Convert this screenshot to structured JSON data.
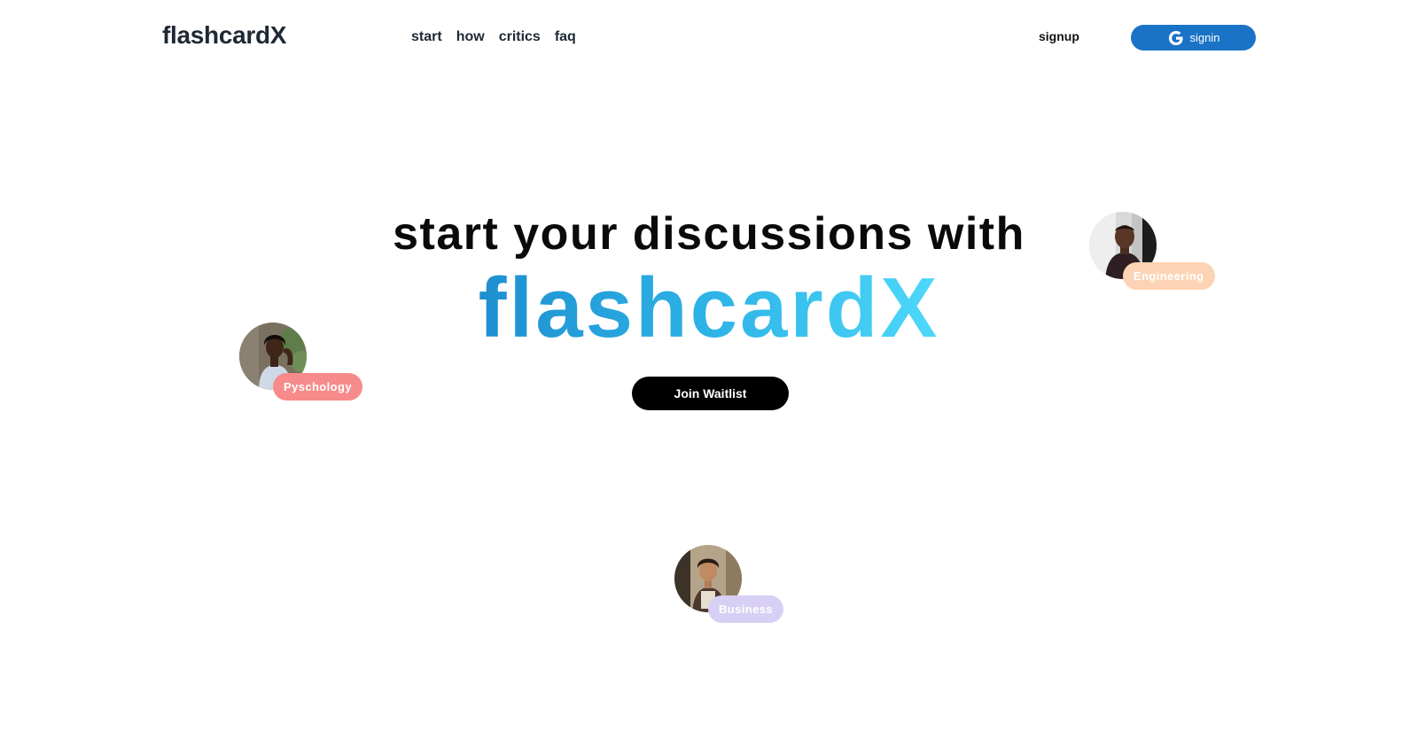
{
  "header": {
    "logo": "flashcardX",
    "nav": [
      {
        "label": "start"
      },
      {
        "label": "how"
      },
      {
        "label": "critics"
      },
      {
        "label": "faq"
      }
    ],
    "signup_label": "signup",
    "signin_label": "signin",
    "signin_icon": "google-icon",
    "signin_color": "#1a73c6"
  },
  "hero": {
    "headline": "start your discussions with",
    "brand": "flashcardX",
    "brand_gradient": [
      "#1e8fd0",
      "#4dd8fb"
    ],
    "cta_label": "Join Waitlist"
  },
  "personas": [
    {
      "tag": "Engineering",
      "tag_color": "#fcd3b4",
      "icon": "person-avatar"
    },
    {
      "tag": "Pyschology",
      "tag_color": "#f78b8b",
      "icon": "person-avatar"
    },
    {
      "tag": "Business",
      "tag_color": "#d7d0f4",
      "icon": "person-avatar"
    }
  ]
}
